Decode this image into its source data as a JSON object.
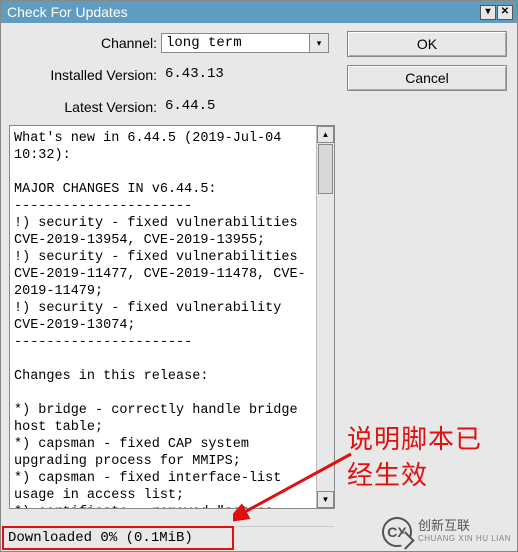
{
  "window": {
    "title": "Check For Updates"
  },
  "form": {
    "channel_label": "Channel:",
    "channel_value": "long term",
    "installed_label": "Installed Version:",
    "installed_value": "6.43.13",
    "latest_label": "Latest Version:",
    "latest_value": "6.44.5"
  },
  "buttons": {
    "ok": "OK",
    "cancel": "Cancel"
  },
  "changelog": "What's new in 6.44.5 (2019-Jul-04 10:32):\n\nMAJOR CHANGES IN v6.44.5:\n----------------------\n!) security - fixed vulnerabilities CVE-2019-13954, CVE-2019-13955;\n!) security - fixed vulnerabilities CVE-2019-11477, CVE-2019-11478, CVE-2019-11479;\n!) security - fixed vulnerability CVE-2019-13074;\n----------------------\n\nChanges in this release:\n\n*) bridge - correctly handle bridge host table;\n*) capsman - fixed CAP system upgrading process for MMIPS;\n*) capsman - fixed interface-list usage in access list;\n*) certificate - removed \"set-ca-passphrase\" parameter;\n*) cloud - properly stop \"ti  -zone-",
  "status": {
    "text": "Downloaded 0% (0.1MiB)"
  },
  "annotation": {
    "text": "说明脚本已经生效"
  },
  "watermark": {
    "icon_text": "CX",
    "cn": "创新互联",
    "en": "CHUANG XIN HU LIAN"
  }
}
